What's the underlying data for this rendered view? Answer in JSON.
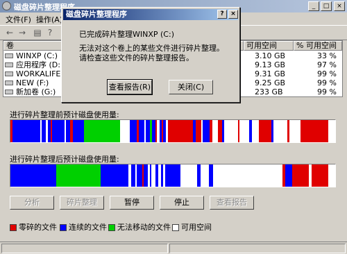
{
  "window": {
    "title": "磁盘碎片整理程序",
    "min": "_",
    "max": "□",
    "close": "×"
  },
  "menu": [
    "文件(F)",
    "操作(A)"
  ],
  "table": {
    "headers": {
      "volume": "卷",
      "free": "可用空间",
      "pct": "% 可用空间"
    },
    "rows": [
      {
        "name": "WINXP (C:)",
        "free": "3.10 GB",
        "pct": "33 %"
      },
      {
        "name": "应用程序 (D:)",
        "free": "9.13 GB",
        "pct": "97 %"
      },
      {
        "name": "WORKALIFE (E:)",
        "free": "9.31 GB",
        "pct": "99 %"
      },
      {
        "name": "NEW (F:)",
        "free": "9.25 GB",
        "pct": "99 %"
      },
      {
        "name": "新加卷 (G:)",
        "free": "233 GB",
        "pct": "99 %"
      }
    ]
  },
  "before_label": "进行碎片整理前预计磁盘使用量:",
  "after_label": "进行碎片整理后预计磁盘使用量:",
  "buttons": {
    "analyze": "分析",
    "defrag": "碎片整理",
    "pause": "暂停",
    "stop": "停止",
    "report": "查看报告"
  },
  "legend": {
    "fragmented": "零碎的文件",
    "contiguous": "连续的文件",
    "unmovable": "无法移动的文件",
    "free": "可用空间"
  },
  "colors": {
    "fragmented": "#e00000",
    "contiguous": "#0000ff",
    "unmovable": "#00d000",
    "free": "#ffffff"
  },
  "dialog": {
    "title": "磁盘碎片整理程序",
    "help": "?",
    "close": "×",
    "line1": "已完成碎片整理WINXP (C:)",
    "line2": "无法对这个卷上的某些文件进行碎片整理。",
    "line3": "请检查这些文件的碎片整理报告。",
    "view_report": "查看报告(R)",
    "close_btn": "关闭(C)"
  }
}
